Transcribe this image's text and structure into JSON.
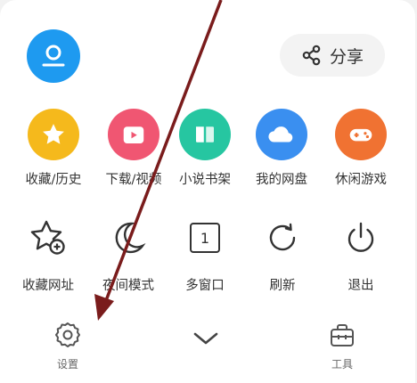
{
  "header": {
    "share_label": "分享"
  },
  "grid_row1": [
    {
      "label": "收藏/历史",
      "icon": "star-icon",
      "color": "#f5b91c"
    },
    {
      "label": "下载/视频",
      "icon": "play-icon",
      "color": "#f05672"
    },
    {
      "label": "小说书架",
      "icon": "book-icon",
      "color": "#26c6a1"
    },
    {
      "label": "我的网盘",
      "icon": "cloud-icon",
      "color": "#3a8ff0"
    },
    {
      "label": "休闲游戏",
      "icon": "gamepad-icon",
      "color": "#f07232"
    }
  ],
  "grid_row2": [
    {
      "label": "收藏网址",
      "icon": "star-add-icon"
    },
    {
      "label": "夜间模式",
      "icon": "moon-icon"
    },
    {
      "label": "多窗口",
      "icon": "window-count-icon",
      "badge": "1"
    },
    {
      "label": "刷新",
      "icon": "refresh-icon"
    },
    {
      "label": "退出",
      "icon": "power-icon"
    }
  ],
  "bottom": {
    "settings_label": "设置",
    "tools_label": "工具"
  },
  "colors": {
    "avatar": "#1e9af0",
    "arrow": "#7a1c1c"
  }
}
